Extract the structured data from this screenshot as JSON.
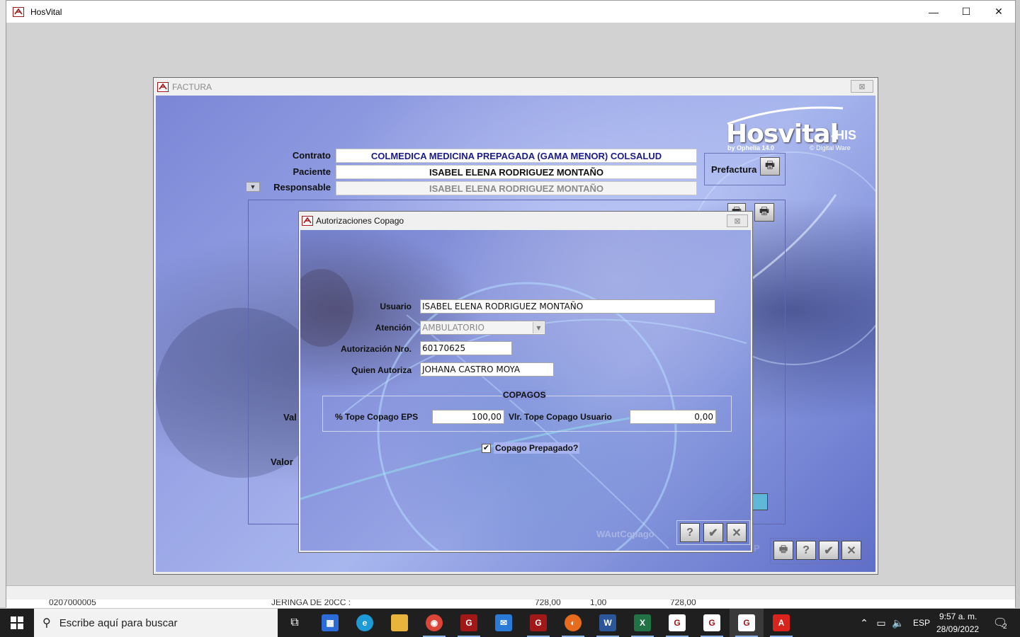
{
  "app": {
    "title": "HosVital",
    "controls": {
      "minimize": "—",
      "maximize": "☐",
      "close": "✕"
    }
  },
  "background_row": {
    "code": "0207000005",
    "description": "JERINGA DE 20CC :",
    "value1": "728,00",
    "qty": "1,00",
    "value2": "728,00"
  },
  "factura": {
    "title": "FACTURA",
    "logo": {
      "main": "Hosvital",
      "suffix": "-HIS",
      "by": "by Ophelia 14.0",
      "company": "© Digital Ware"
    },
    "contrato": {
      "label": "Contrato",
      "value": "COLMEDICA MEDICINA PREPAGADA (GAMA MENOR) COLSALUD"
    },
    "paciente": {
      "label": "Paciente",
      "value": "ISABEL ELENA RODRIGUEZ MONTAÑO"
    },
    "responsable": {
      "label": "Responsable",
      "value": "ISABEL ELENA RODRIGUEZ MONTAÑO"
    },
    "prefactura_label": "Prefactura",
    "partial_labels": {
      "val": "Val",
      "valor": "Valor",
      "p": "P"
    }
  },
  "dialog": {
    "title": "Autorizaciones Copago",
    "usuario": {
      "label": "Usuario",
      "value": "ISABEL ELENA RODRIGUEZ MONTAÑO"
    },
    "atencion": {
      "label": "Atención",
      "value": "AMBULATORIO"
    },
    "autorizacion": {
      "label": "Autorización Nro.",
      "value": "60170625"
    },
    "quien_autoriza": {
      "label": "Quien Autoriza",
      "value": "JOHANA CASTRO MOYA"
    },
    "copagos": {
      "title": "COPAGOS",
      "tope_eps": {
        "label": "% Tope Copago EPS",
        "value": "100,00"
      },
      "tope_usuario": {
        "label": "Vlr. Tope Copago Usuario",
        "value": "0,00"
      }
    },
    "copago_prepagado": {
      "label": "Copago Prepagado?",
      "checked": true
    },
    "window_name": "WAutCopago",
    "buttons": {
      "help": "?",
      "accept": "✔",
      "cancel": "✕"
    }
  },
  "taskbar": {
    "search_placeholder": "Escribe aquí para buscar",
    "language": "ESP",
    "time": "9:57 a. m.",
    "date": "28/09/2022",
    "notifications": "2"
  }
}
